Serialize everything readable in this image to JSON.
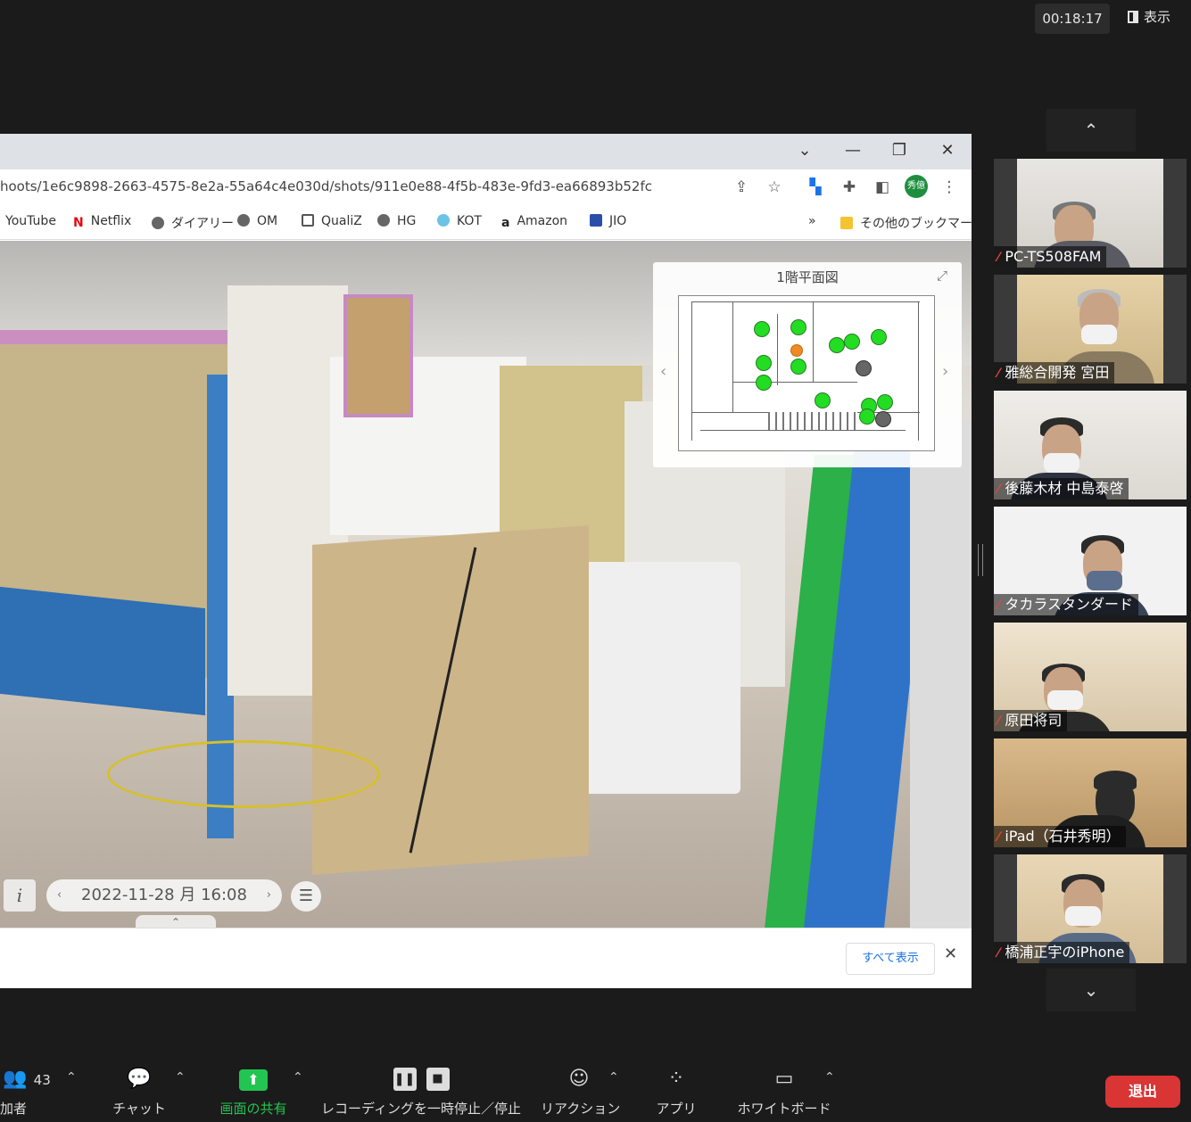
{
  "meeting": {
    "timer": "00:18:17",
    "view_label": "表示"
  },
  "browser": {
    "url": "hoots/1e6c9898-2663-4575-8e2a-55a64c4e030d/shots/911e0e88-4f5b-483e-9fd3-ea66893b52fc",
    "profile_label": "秀億",
    "bookmarks": [
      {
        "label": "YouTube",
        "icon": "youtube-icon"
      },
      {
        "label": "Netflix",
        "icon": "netflix-icon"
      },
      {
        "label": "ダイアリー",
        "icon": "globe-icon"
      },
      {
        "label": "OM",
        "icon": "globe-icon"
      },
      {
        "label": "QualiZ",
        "icon": "doc-icon"
      },
      {
        "label": "HG",
        "icon": "globe-icon"
      },
      {
        "label": "KOT",
        "icon": "clock-icon"
      },
      {
        "label": "Amazon",
        "icon": "amazon-icon"
      },
      {
        "label": "JIO",
        "icon": "jio-icon"
      }
    ],
    "other_bookmarks": "その他のブックマーク",
    "more_bookmarks": "»"
  },
  "viewer": {
    "minimap_title": "1階平面図",
    "date": "2022-11-28 月 16:08",
    "info_label": "i",
    "prev_arrow": "‹",
    "next_arrow": "›",
    "list_icon": "☰",
    "caret": "⌃"
  },
  "download_bar": {
    "show_all": "すべて表示",
    "close": "✕"
  },
  "participants": [
    {
      "name": "PC-TS508FAM",
      "muted": true
    },
    {
      "name": "雅総合開発 宮田",
      "muted": true
    },
    {
      "name": "後藤木材 中島泰啓",
      "muted": true
    },
    {
      "name": "タカラスタンダード",
      "muted": true
    },
    {
      "name": "原田将司",
      "muted": true
    },
    {
      "name": "iPad（石井秀明）",
      "muted": true
    },
    {
      "name": "橋浦正宇のiPhone",
      "muted": true
    }
  ],
  "toolbar": {
    "participants_count": "43",
    "participants_label": "加者",
    "chat_label": "チャット",
    "share_label": "画面の共有",
    "record_label": "レコーディングを一時停止／停止",
    "reaction_label": "リアクション",
    "apps_label": "アプリ",
    "whiteboard_label": "ホワイトボード",
    "leave_label": "退出"
  },
  "colors": {
    "share_green": "#23c552",
    "leave_red": "#d93535",
    "dot_green": "#22dd22",
    "dot_gray": "#666666",
    "dot_orange": "#f08a24"
  }
}
